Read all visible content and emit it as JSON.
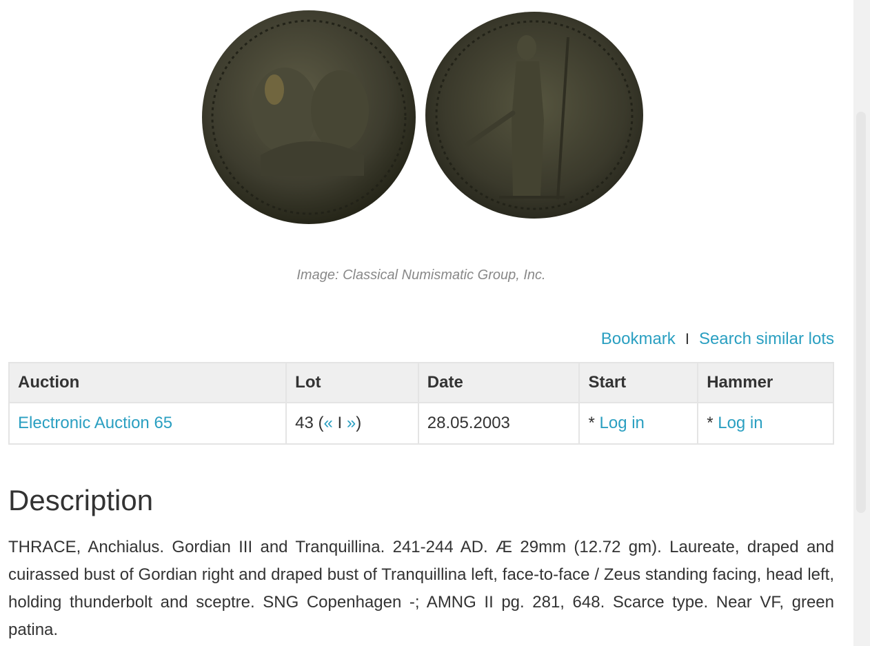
{
  "image": {
    "caption": "Image: Classical Numismatic Group, Inc."
  },
  "actions": {
    "bookmark": "Bookmark",
    "separator": "I",
    "search_similar": "Search similar lots"
  },
  "table": {
    "headers": [
      "Auction",
      "Lot",
      "Date",
      "Start",
      "Hammer"
    ],
    "row": {
      "auction": "Electronic Auction 65",
      "lot_number": "43 (",
      "prev_lot": "«",
      "lot_sep": " I ",
      "next_lot": "»",
      "lot_close": ")",
      "date": "28.05.2003",
      "start_prefix": "* ",
      "start_link": "Log in",
      "hammer_prefix": "* ",
      "hammer_link": "Log in"
    }
  },
  "description": {
    "heading": "Description",
    "text": "THRACE, Anchialus. Gordian III and Tranquillina. 241-244 AD. Æ 29mm (12.72 gm). Laureate, draped and cuirassed bust of Gordian right and draped bust of Tranquillina left, face-to-face / Zeus standing facing, head left, holding thunderbolt and sceptre. SNG Copenhagen -; AMNG II pg. 281, 648. Scarce type. Near VF, green patina."
  },
  "colors": {
    "link": "#2a9fc1",
    "text": "#333333",
    "table_header_bg": "#efefef",
    "caption": "#888888"
  }
}
